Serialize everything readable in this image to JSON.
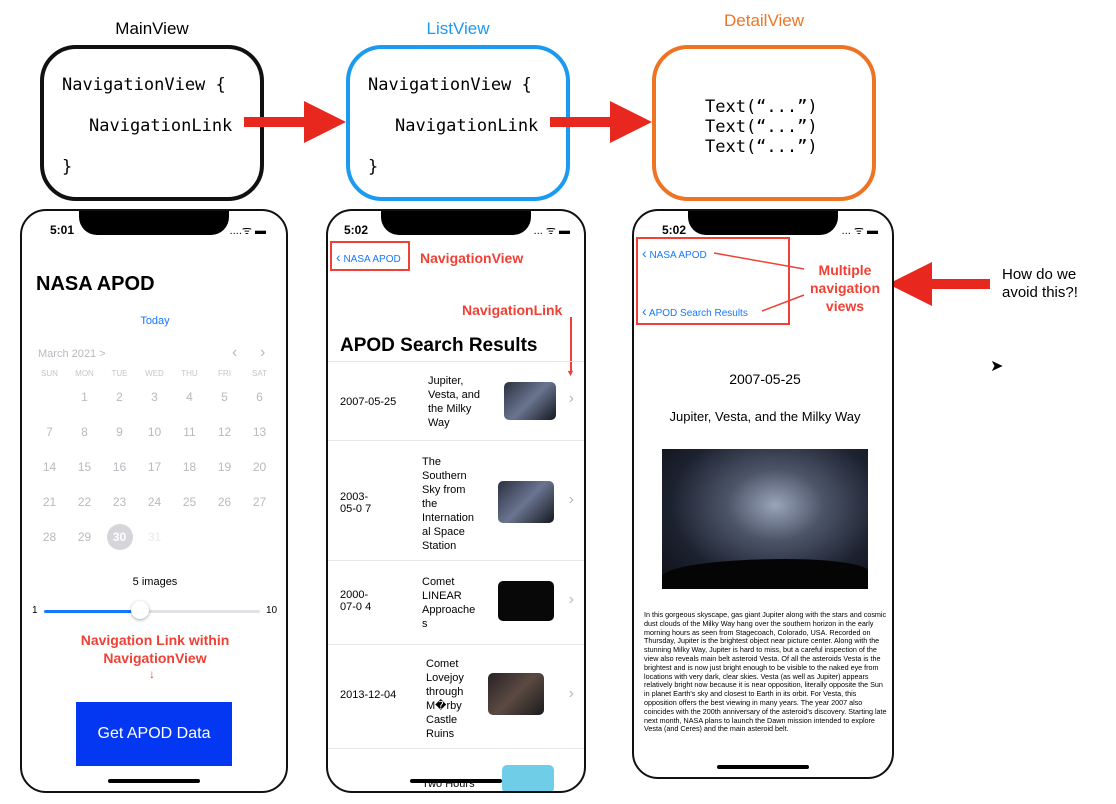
{
  "diagram": {
    "main_view": {
      "title": "MainView",
      "code": [
        "NavigationView {",
        "NavigationLink",
        "}"
      ]
    },
    "list_view": {
      "title": "ListView",
      "code": [
        "NavigationView {",
        "NavigationLink",
        "}"
      ]
    },
    "detail_view": {
      "title": "DetailView",
      "code": [
        "Text(“...”)",
        "Text(“...”)",
        "Text(“...”)"
      ]
    },
    "question": "How do we avoid this?!"
  },
  "colors": {
    "list_view": "#1a9bf0",
    "detail_view": "#ee7424",
    "arrow": "#e8281e",
    "accent": "#1677ff"
  },
  "phone1": {
    "time": "5:01",
    "status": "....ᯤ ▬",
    "title": "NASA APOD",
    "today": "Today",
    "month": "March 2021 >",
    "weekdays": [
      "SUN",
      "MON",
      "TUE",
      "WED",
      "THU",
      "FRI",
      "SAT"
    ],
    "weeks": [
      [
        "",
        "1",
        "2",
        "3",
        "4",
        "5",
        "6"
      ],
      [
        "7",
        "8",
        "9",
        "10",
        "11",
        "12",
        "13"
      ],
      [
        "14",
        "15",
        "16",
        "17",
        "18",
        "19",
        "20"
      ],
      [
        "21",
        "22",
        "23",
        "24",
        "25",
        "26",
        "27"
      ],
      [
        "28",
        "29",
        "30",
        "31",
        "",
        "",
        ""
      ]
    ],
    "images_label": "5 images",
    "slider_min": "1",
    "slider_max": "10",
    "slider_value": 5,
    "annotation": "Navigation Link within NavigationView",
    "button": "Get APOD Data"
  },
  "phone2": {
    "time": "5:02",
    "status": "... ᯤ ▬",
    "back": "NASA APOD",
    "annotation_nav": "NavigationView",
    "annotation_link": "NavigationLink",
    "header": "APOD Search Results",
    "rows": [
      {
        "date": "2007-05-25",
        "name": "Jupiter, Vesta, and the Milky Way"
      },
      {
        "date": "2003-05-0 7",
        "name": "The Southern Sky from the Internation al Space Station"
      },
      {
        "date": "2000-07-0 4",
        "name": "Comet LINEAR Approache s"
      },
      {
        "date": "2013-12-04",
        "name": "Comet Lovejoy through M�rby Castle Ruins"
      },
      {
        "date": "",
        "name": "Two Hours"
      }
    ]
  },
  "phone3": {
    "time": "5:02",
    "status": "... ᯤ ▬",
    "back1": "NASA APOD",
    "back2": "APOD Search Results",
    "annotation": "Multiple navigation views",
    "date": "2007-05-25",
    "title": "Jupiter, Vesta, and the Milky Way",
    "description": "In this gorgeous skyscape, gas giant Jupiter along with the stars and cosmic dust clouds of the Milky Way hang over the southern horizon in the early morning hours as seen from Stagecoach, Colorado, USA. Recorded on Thursday, Jupiter is the brightest object near picture center. Along with the stunning Milky Way, Jupiter is hard to miss, but a careful inspection of the view also reveals main belt asteroid Vesta. Of all the asteroids Vesta is the brightest and is now just bright enough to be visible to the naked eye from locations with very dark, clear skies. Vesta (as well as Jupiter) appears relatively bright now because it is near opposition, literally opposite the Sun in planet Earth's sky and closest to Earth in its orbit. For Vesta, this opposition offers the best viewing in many years. The year 2007 also coincides with the 200th anniversary of the asteroid's discovery. Starting late next month, NASA plans to launch the Dawn mission intended to explore Vesta (and Ceres) and the main asteroid belt."
  }
}
